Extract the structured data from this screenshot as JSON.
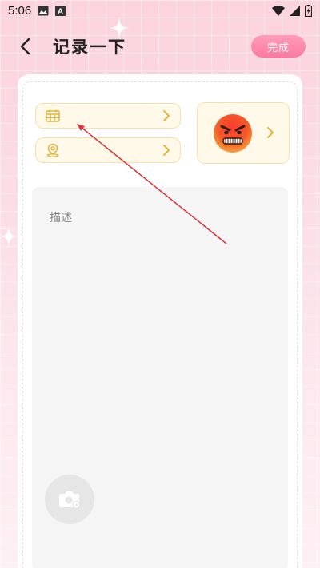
{
  "status_bar": {
    "time": "5:06",
    "icons": [
      "image-icon",
      "a-badge-icon",
      "wifi-icon",
      "signal-icon",
      "battery-charging-icon"
    ]
  },
  "header": {
    "back_icon": "chevron-left-icon",
    "title": "记录一下",
    "done_label": "完成"
  },
  "form": {
    "date_icon": "calendar-icon",
    "location_icon": "location-pin-icon",
    "mood_icon": "angry-face-icon",
    "chevron_icon": "chevron-right-icon",
    "description_placeholder": "描述",
    "photo_icon": "camera-icon"
  },
  "colors": {
    "accent": "#fb7aa1",
    "pill_bg": "#fff9e9",
    "pill_border": "#f6e1ad",
    "icon_gold": "#e6b43c",
    "annotation_arrow": "#d9363e"
  }
}
